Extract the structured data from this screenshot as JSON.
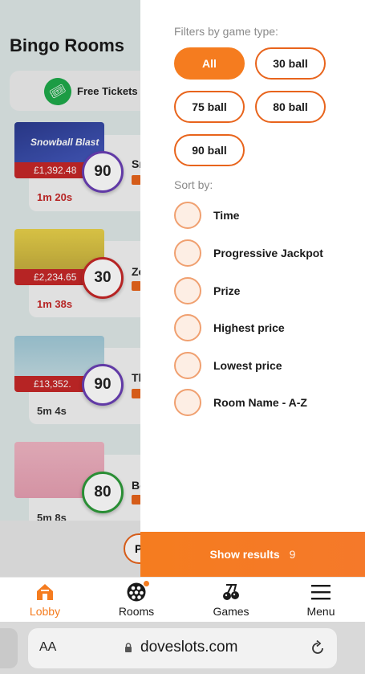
{
  "lobby": {
    "title": "Bingo Rooms",
    "free_tickets_label": "Free Tickets",
    "rooms": [
      {
        "image_text": "Snowball Blast",
        "jackpot": "£1,392.48",
        "ball": "90",
        "time": "1m 20s",
        "name_fragment": "Sn",
        "ball_color": "#6a3fb5",
        "time_color": "#c62828"
      },
      {
        "image_text": "",
        "jackpot": "£2,234.65",
        "ball": "30",
        "time": "1m 38s",
        "name_fragment": "Zo",
        "ball_color": "#c62828",
        "time_color": "#c62828"
      },
      {
        "image_text": "",
        "jackpot": "£13,352.",
        "ball": "90",
        "time": "5m 4s",
        "name_fragment": "Th",
        "ball_color": "#6a3fb5",
        "time_color": "#333333"
      },
      {
        "image_text": "",
        "jackpot": "",
        "ball": "80",
        "time": "5m 8s",
        "name_fragment": "Be",
        "ball_color": "#2e9b3a",
        "time_color": "#333333"
      }
    ],
    "play_fragment": "P"
  },
  "filters": {
    "label": "Filters by game type:",
    "options": [
      {
        "label": "All",
        "active": true
      },
      {
        "label": "30 ball",
        "active": false
      },
      {
        "label": "75 ball",
        "active": false
      },
      {
        "label": "80 ball",
        "active": false
      },
      {
        "label": "90 ball",
        "active": false
      }
    ]
  },
  "sort": {
    "label": "Sort by:",
    "options": [
      "Time",
      "Progressive Jackpot",
      "Prize",
      "Highest price",
      "Lowest price",
      "Room Name - A-Z"
    ]
  },
  "show_results": {
    "label": "Show results",
    "count": "9"
  },
  "tabbar": [
    {
      "label": "Lobby",
      "icon": "home-icon",
      "active": true
    },
    {
      "label": "Rooms",
      "icon": "bingo-balls-icon",
      "active": false,
      "notification": true
    },
    {
      "label": "Games",
      "icon": "cherries-icon",
      "active": false
    },
    {
      "label": "Menu",
      "icon": "hamburger-icon",
      "active": false
    }
  ],
  "browser": {
    "text_size": "AA",
    "url": "doveslots.com"
  },
  "colors": {
    "accent": "#f57c1f",
    "accent_border": "#e8641c",
    "radio_fill": "#fdeee4"
  }
}
